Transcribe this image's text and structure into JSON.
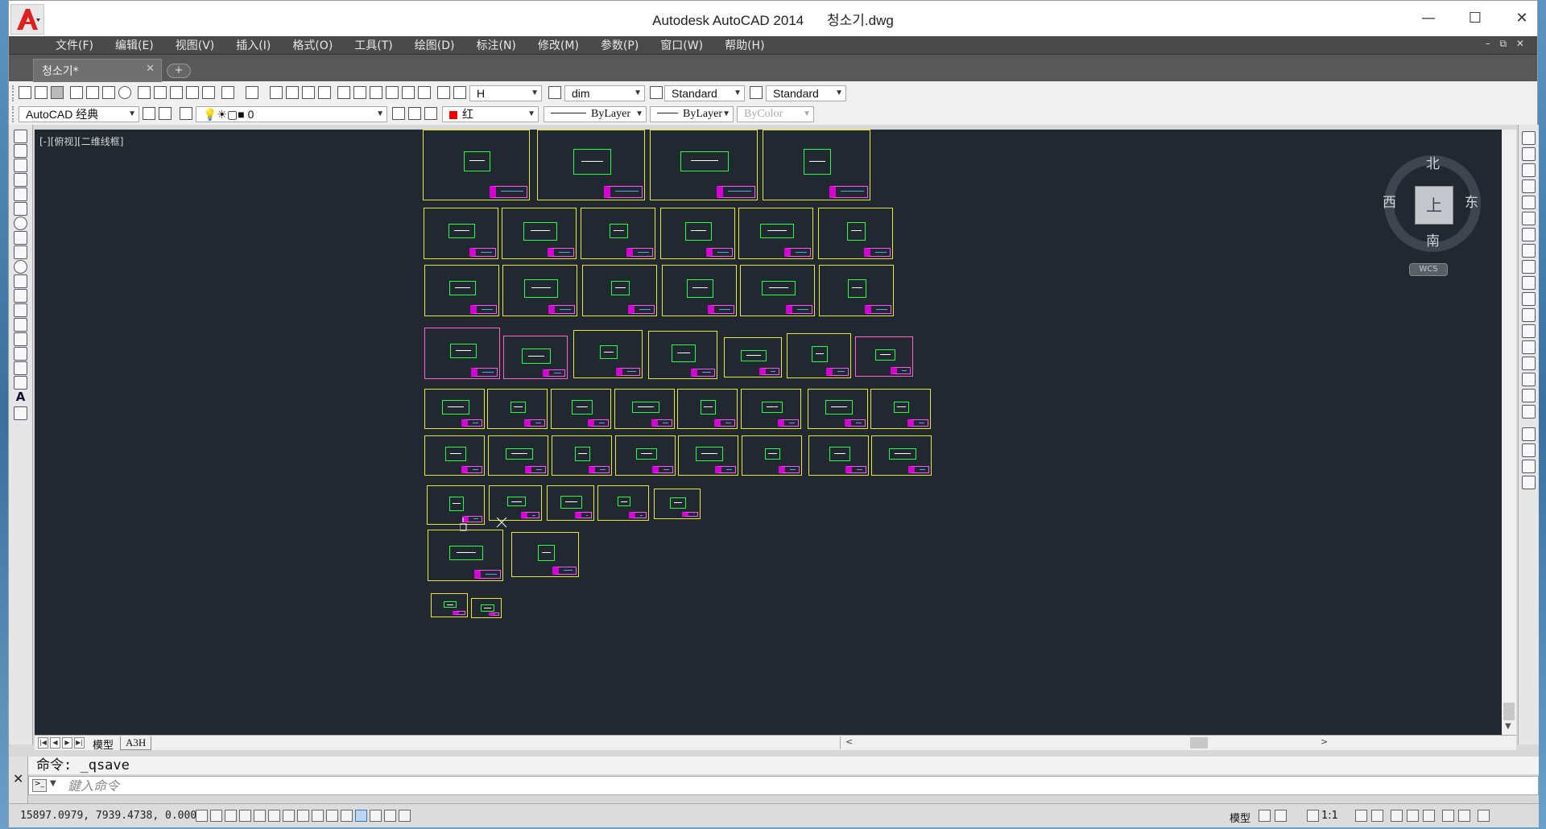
{
  "window": {
    "app_title": "Autodesk AutoCAD 2014",
    "file_title": "청소기.dwg",
    "minimize": "—",
    "maximize": "☐",
    "close": "✕"
  },
  "menu": [
    "文件(F)",
    "编辑(E)",
    "视图(V)",
    "插入(I)",
    "格式(O)",
    "工具(T)",
    "绘图(D)",
    "标注(N)",
    "修改(M)",
    "参数(P)",
    "窗口(W)",
    "帮助(H)"
  ],
  "mdi_controls": "– ⧉ ✕",
  "file_tab": {
    "label": "청소기*",
    "close": "✕",
    "new": "+"
  },
  "toolbar": {
    "text_style": "H",
    "dim_style": "dim",
    "table_style": "Standard",
    "mleader_style": "Standard",
    "workspace": "AutoCAD 经典",
    "layer": "0",
    "color": "红",
    "linetype": "ByLayer",
    "lineweight": "ByLayer",
    "plotstyle": "ByColor",
    "accent_color": "#ff0000"
  },
  "viewport": {
    "label": "[-][俯视][二维线框]",
    "viewcube": {
      "top": "上",
      "north": "北",
      "south": "南",
      "east": "东",
      "west": "西",
      "wcs": "WCS"
    }
  },
  "layout_tabs": {
    "model": "模型",
    "layout": "A3H",
    "nav": [
      "|◀",
      "◀",
      "▶",
      "▶|"
    ],
    "scroll_left": "<",
    "scroll_right": ">"
  },
  "command": {
    "history": "命令:  _qsave",
    "placeholder": "鍵入命令",
    "close_icon": "✕"
  },
  "status": {
    "coordinates": "15897.0979,  7939.4738,  0.0000",
    "model_label": "模型",
    "scale_label": "1:1",
    "annotation_icon": "annotation-scale-icon"
  },
  "colors": {
    "canvas": "#212830",
    "sheet_border": "#e8e838",
    "titleblock": "#d400d4",
    "geometry": "#22ff44"
  }
}
